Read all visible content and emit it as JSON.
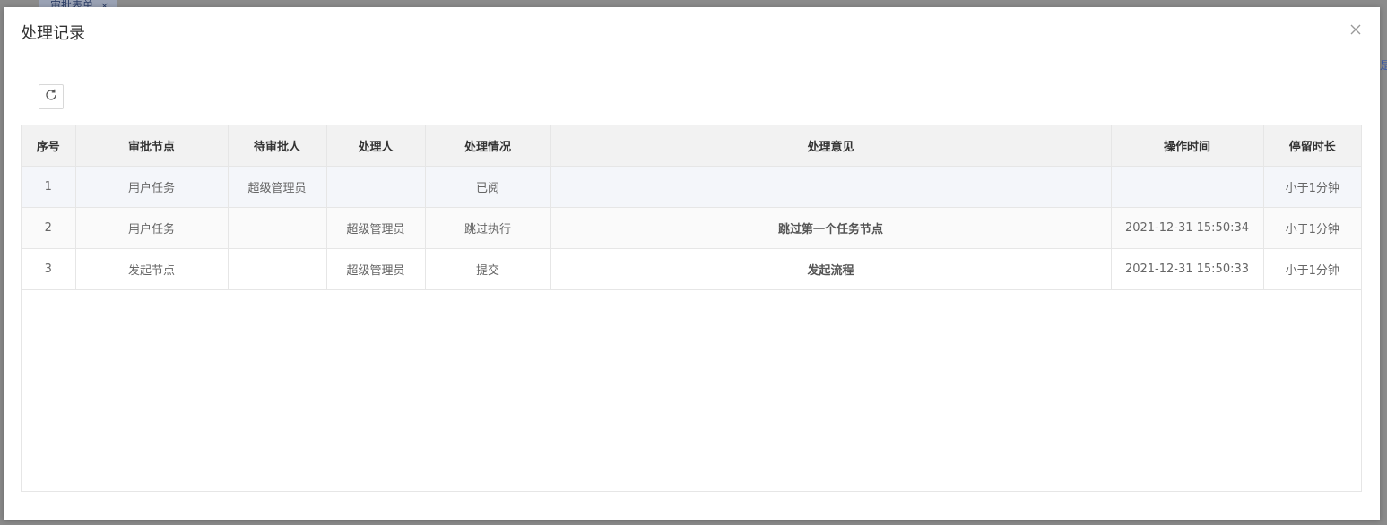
{
  "background": {
    "tab_label": "审批表单",
    "tab_close": "×",
    "side_link": "是"
  },
  "modal": {
    "title": "处理记录",
    "close_icon": "close-icon"
  },
  "toolbar": {
    "refresh_icon": "refresh-icon"
  },
  "table": {
    "columns": [
      "序号",
      "审批节点",
      "待审批人",
      "处理人",
      "处理情况",
      "处理意见",
      "操作时间",
      "停留时长"
    ],
    "rows": [
      {
        "index": "1",
        "node": "用户任务",
        "pending": "超级管理员",
        "handler": "",
        "status": "已阅",
        "opinion": "",
        "time": "",
        "duration": "小于1分钟"
      },
      {
        "index": "2",
        "node": "用户任务",
        "pending": "",
        "handler": "超级管理员",
        "status": "跳过执行",
        "opinion": "跳过第一个任务节点",
        "time": "2021-12-31 15:50:34",
        "duration": "小于1分钟"
      },
      {
        "index": "3",
        "node": "发起节点",
        "pending": "",
        "handler": "超级管理员",
        "status": "提交",
        "opinion": "发起流程",
        "time": "2021-12-31 15:50:33",
        "duration": "小于1分钟"
      }
    ]
  },
  "colors": {
    "header_bg": "#f2f2f2",
    "highlight_row": "#f4f6fa",
    "border": "#e6e6e6",
    "overlay": "#7a7a7a"
  }
}
